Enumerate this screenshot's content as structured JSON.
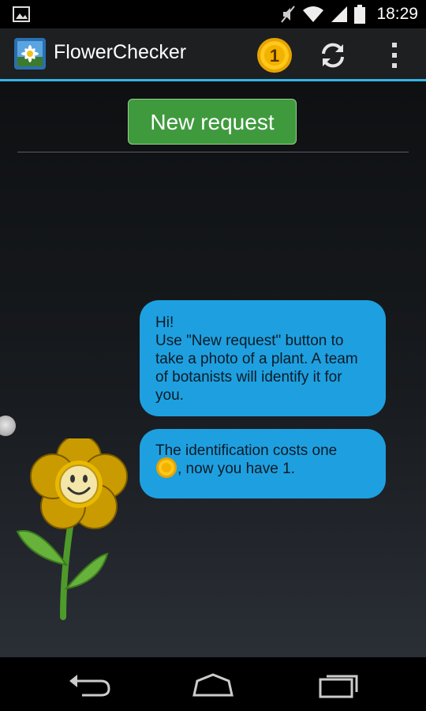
{
  "status_bar": {
    "time": "18:29",
    "icons": [
      "image-notification-icon",
      "mute-icon",
      "wifi-icon",
      "signal-icon",
      "battery-icon"
    ]
  },
  "action_bar": {
    "title": "FlowerChecker",
    "coin_count": "1",
    "accent_color": "#33b5e5",
    "icons": [
      "app-logo-icon",
      "coin-icon",
      "refresh-icon",
      "overflow-menu-icon"
    ]
  },
  "main": {
    "new_request_label": "New request",
    "button_color": "#3f9a3e",
    "bubble_color": "#1ea0e0",
    "messages": [
      {
        "lines": [
          "Hi!",
          "Use \"New request\" button to",
          "take a photo of a plant. A team",
          "of botanists will identify it for",
          "you."
        ]
      },
      {
        "line1": "The identification costs one",
        "line2_suffix": ", now you have 1."
      }
    ],
    "mascot": "smiling-flower-icon"
  },
  "nav_bar": {
    "icons": [
      "back-icon",
      "home-icon",
      "recents-icon"
    ]
  }
}
